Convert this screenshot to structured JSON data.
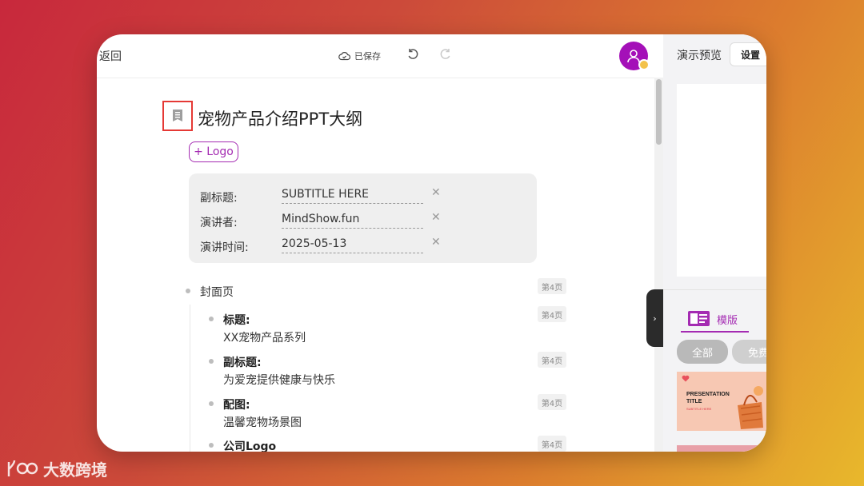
{
  "topbar": {
    "back_label": "返回",
    "saved_label": "已保存"
  },
  "document": {
    "title": "宠物产品介绍PPT大纲",
    "logo_button": "+ Logo",
    "meta": [
      {
        "label": "副标题:",
        "value": "SUBTITLE HERE"
      },
      {
        "label": "演讲者:",
        "value": "MindShow.fun"
      },
      {
        "label": "演讲时间:",
        "value": "2025-05-13"
      }
    ],
    "outline": [
      {
        "text": "封面页",
        "page": "第4页"
      },
      {
        "heading": "标题:",
        "text": "XX宠物产品系列",
        "page": "第4页"
      },
      {
        "heading": "副标题:",
        "text": "为爱宠提供健康与快乐",
        "page": "第4页"
      },
      {
        "heading": "配图:",
        "text": "温馨宠物场景图",
        "page": "第4页"
      },
      {
        "heading": "公司Logo",
        "page": "第4页"
      }
    ]
  },
  "right_panel": {
    "title": "演示预览",
    "settings_label": "设置",
    "template_tab": "模版",
    "filters": [
      "全部",
      "免费"
    ],
    "template_card": {
      "line1": "PRESENTATION",
      "line2": "TITLE",
      "sub": "SUBTITLE HERE"
    }
  },
  "watermark": "大数跨境",
  "colors": {
    "accent": "#a42bb2",
    "highlight_box": "#e53935"
  }
}
